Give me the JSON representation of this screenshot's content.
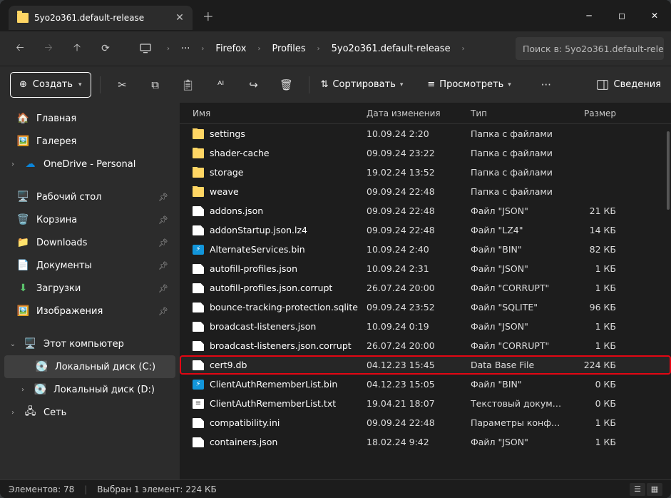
{
  "titlebar": {
    "tab_title": "5yo2o361.default-release"
  },
  "breadcrumbs": {
    "overflow": "···",
    "items": [
      "Firefox",
      "Profiles",
      "5yo2o361.default-release"
    ]
  },
  "search": {
    "placeholder": "Поиск в: 5yo2o361.default-rele"
  },
  "toolbar": {
    "create": "Создать",
    "sort": "Сортировать",
    "view": "Просмотреть",
    "details": "Сведения"
  },
  "sidebar": {
    "home": "Главная",
    "gallery": "Галерея",
    "onedrive": "OneDrive - Personal",
    "desktop": "Рабочий стол",
    "recycle": "Корзина",
    "downloads": "Downloads",
    "documents": "Документы",
    "downloads2": "Загрузки",
    "pictures": "Изображения",
    "thispc": "Этот компьютер",
    "diskC": "Локальный диск (C:)",
    "diskD": "Локальный диск (D:)",
    "network": "Сеть"
  },
  "columns": {
    "name": "Имя",
    "date": "Дата изменения",
    "type": "Тип",
    "size": "Размер"
  },
  "rows": [
    {
      "ico": "folder",
      "name": "settings",
      "date": "10.09.24 2:20",
      "type": "Папка с файлами",
      "size": ""
    },
    {
      "ico": "folder",
      "name": "shader-cache",
      "date": "09.09.24 23:22",
      "type": "Папка с файлами",
      "size": ""
    },
    {
      "ico": "folder",
      "name": "storage",
      "date": "19.02.24 13:52",
      "type": "Папка с файлами",
      "size": ""
    },
    {
      "ico": "folder",
      "name": "weave",
      "date": "09.09.24 22:48",
      "type": "Папка с файлами",
      "size": ""
    },
    {
      "ico": "file",
      "name": "addons.json",
      "date": "09.09.24 22:48",
      "type": "Файл \"JSON\"",
      "size": "21 КБ"
    },
    {
      "ico": "file",
      "name": "addonStartup.json.lz4",
      "date": "09.09.24 22:48",
      "type": "Файл \"LZ4\"",
      "size": "14 КБ"
    },
    {
      "ico": "bin",
      "name": "AlternateServices.bin",
      "date": "10.09.24 2:40",
      "type": "Файл \"BIN\"",
      "size": "82 КБ"
    },
    {
      "ico": "file",
      "name": "autofill-profiles.json",
      "date": "10.09.24 2:31",
      "type": "Файл \"JSON\"",
      "size": "1 КБ"
    },
    {
      "ico": "file",
      "name": "autofill-profiles.json.corrupt",
      "date": "26.07.24 20:00",
      "type": "Файл \"CORRUPT\"",
      "size": "1 КБ"
    },
    {
      "ico": "file",
      "name": "bounce-tracking-protection.sqlite",
      "date": "09.09.24 23:52",
      "type": "Файл \"SQLITE\"",
      "size": "96 КБ"
    },
    {
      "ico": "file",
      "name": "broadcast-listeners.json",
      "date": "10.09.24 0:19",
      "type": "Файл \"JSON\"",
      "size": "1 КБ"
    },
    {
      "ico": "file",
      "name": "broadcast-listeners.json.corrupt",
      "date": "26.07.24 20:00",
      "type": "Файл \"CORRUPT\"",
      "size": "1 КБ"
    },
    {
      "ico": "file",
      "name": "cert9.db",
      "date": "04.12.23 15:45",
      "type": "Data Base File",
      "size": "224 КБ",
      "highlight": true
    },
    {
      "ico": "bin",
      "name": "ClientAuthRememberList.bin",
      "date": "04.12.23 15:05",
      "type": "Файл \"BIN\"",
      "size": "0 КБ"
    },
    {
      "ico": "txt",
      "name": "ClientAuthRememberList.txt",
      "date": "19.04.21 18:07",
      "type": "Текстовый докум…",
      "size": "0 КБ"
    },
    {
      "ico": "file",
      "name": "compatibility.ini",
      "date": "09.09.24 22:48",
      "type": "Параметры конф…",
      "size": "1 КБ"
    },
    {
      "ico": "file",
      "name": "containers.json",
      "date": "18.02.24 9:42",
      "type": "Файл \"JSON\"",
      "size": "1 КБ"
    }
  ],
  "status": {
    "count": "Элементов: 78",
    "selected": "Выбран 1 элемент: 224 КБ"
  }
}
